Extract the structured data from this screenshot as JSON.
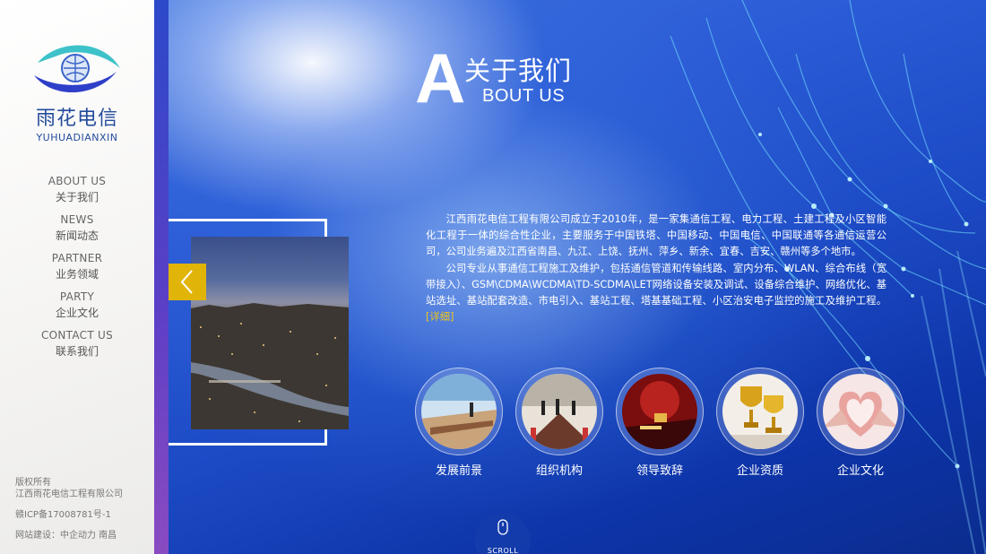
{
  "brand": {
    "name_cn": "雨花电信",
    "name_en": "YUHUADIANXIN"
  },
  "nav": [
    {
      "en": "ABOUT US",
      "cn": "关于我们"
    },
    {
      "en": "NEWS",
      "cn": "新闻动态"
    },
    {
      "en": "PARTNER",
      "cn": "业务领域"
    },
    {
      "en": "PARTY",
      "cn": "企业文化"
    },
    {
      "en": "CONTACT US",
      "cn": "联系我们"
    }
  ],
  "footer": {
    "copyright_label": "版权所有",
    "company": "江西雨花电信工程有限公司",
    "icp": "赣ICP备17008781号-1",
    "builder": "网站建设：中企动力  南昌"
  },
  "section": {
    "title_big_letter": "A",
    "title_cn": "关于我们",
    "title_en_rest": "BOUT US"
  },
  "about": {
    "paragraph1": "江西雨花电信工程有限公司成立于2010年，是一家集通信工程、电力工程、土建工程及小区智能化工程于一体的综合性企业，主要服务于中国铁塔、中国移动、中国电信、中国联通等各通信运营公司，公司业务遍及江西省南昌、九江、上饶、抚州、萍乡、新余、宜春、吉安、赣州等多个地市。",
    "paragraph2": "公司专业从事通信工程施工及维护，包括通信管道和传输线路、室内分布、WLAN、综合布线（宽带接入）、GSM\\CDMA\\WCDMA\\TD-SCDMA\\LET网络设备安装及调试、设备综合维护、网络优化、基站选址、基站配套改造、市电引入、基站工程、塔基基础工程、小区治安电子监控的施工及维护工程。",
    "more_label": "[详细]"
  },
  "features": [
    {
      "label": "发展前景",
      "icon": "meeting-room-photo"
    },
    {
      "label": "组织机构",
      "icon": "boardroom-photo"
    },
    {
      "label": "领导致辞",
      "icon": "red-desk-photo"
    },
    {
      "label": "企业资质",
      "icon": "trophy-photo"
    },
    {
      "label": "企业文化",
      "icon": "heart-hands-photo"
    }
  ],
  "scroll": {
    "label": "SCROLL"
  },
  "colors": {
    "accent_yellow": "#e1b40a",
    "brand_blue": "#234b9c",
    "link_yellow": "#f2c51c"
  }
}
